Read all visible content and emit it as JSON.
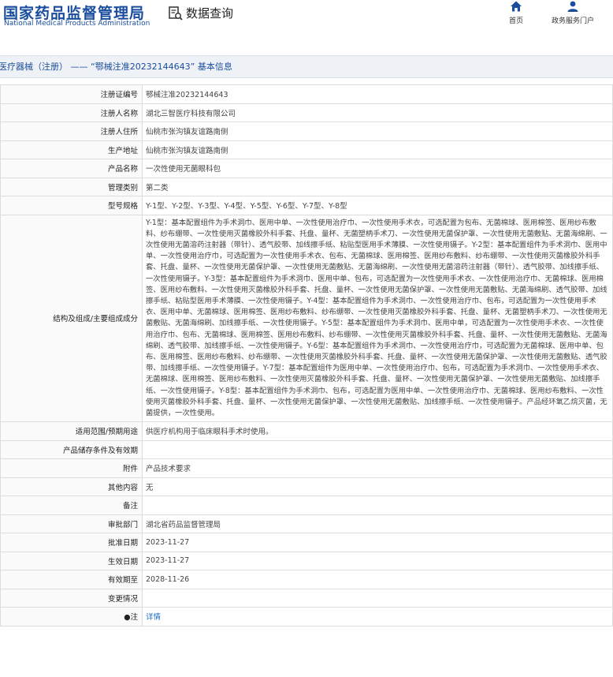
{
  "header": {
    "logo_cn": "国家药品监督管理局",
    "logo_en": "National Medical Products Administration",
    "data_query_label": "数据查询",
    "nav": [
      {
        "label": "首页",
        "icon": "home-icon"
      },
      {
        "label": "政务服务门户",
        "icon": "user-icon"
      }
    ]
  },
  "breadcrumb": "医疗器械（注册） —— “鄂械注准20232144643” 基本信息",
  "colors": {
    "brand": "#1a4d9e",
    "link": "#1a6cc7"
  },
  "rows": [
    {
      "label": "注册证编号",
      "value": "鄂械注准20232144643"
    },
    {
      "label": "注册人名称",
      "value": "湖北三智医疗科技有限公司"
    },
    {
      "label": "注册人住所",
      "value": "仙桃市张沟镇友谊路南侧"
    },
    {
      "label": "生产地址",
      "value": "仙桃市张沟镇友谊路南侧"
    },
    {
      "label": "产品名称",
      "value": "一次性使用无菌眼科包"
    },
    {
      "label": "管理类别",
      "value": "第二类"
    },
    {
      "label": "型号规格",
      "value": "Y-1型、Y-2型、Y-3型、Y-4型、Y-5型、Y-6型、Y-7型、Y-8型"
    },
    {
      "label": "结构及组成/主要组成成分",
      "value": "Y-1型：基本配置组件为手术洞巾、医用中单、一次性使用治疗巾、一次性使用手术衣，可选配置为包布、无菌棉球、医用棉签、医用纱布敷料、纱布绷带、一次性使用灭菌橡胶外科手套、托盘、量杯、无菌塑柄手术刀、一次性使用无菌保护罩、一次性使用无菌敷贴、无菌海绵刷、一次性使用无菌溶药注射器（带针）、透气胶带、加线擦手纸、粘贴型医用手术薄膜、一次性使用镊子。Y-2型：基本配置组件为手术洞巾、医用中单、一次性使用治疗巾，可选配置为一次性使用手术衣、包布、无菌棉球、医用棉签、医用纱布敷料、纱布绷带、一次性使用灭菌橡胶外科手套、托盘、量杯、一次性使用无菌保护罩、一次性使用无菌敷贴、无菌海绵刷、一次性使用无菌溶药注射器（带针）、透气胶带、加线擦手纸、一次性使用镊子。Y-3型：基本配置组件为手术洞巾、医用中单、包布，可选配置为一次性使用手术衣、一次性使用治疗巾、无菌棉球、医用棉签、医用纱布敷料、一次性使用灭菌橡胶外科手套、托盘、量杯、一次性使用无菌保护罩、一次性使用无菌敷贴、无菌海绵刷、透气胶带、加线擦手纸、粘贴型医用手术薄膜、一次性使用镊子。Y-4型：基本配置组件为手术洞巾、一次性使用治疗巾、包布，可选配置为一次性使用手术衣、医用中单、无菌棉球、医用棉签、医用纱布敷料、纱布绷带、一次性使用灭菌橡胶外科手套、托盘、量杯、无菌塑柄手术刀、一次性使用无菌敷贴、无菌海绵刷、加线擦手纸、一次性使用镊子。Y-5型：基本配置组件为手术洞巾、医用中单，可选配置为一次性使用手术衣、一次性使用治疗巾、包布、无菌棉球、医用棉签、医用纱布敷料、纱布绷带、一次性使用灭菌橡胶外科手套、托盘、量杯、一次性使用无菌敷贴、无菌海绵刷、透气胶带、加线擦手纸、一次性使用镊子。Y-6型：基本配置组件为手术洞巾、一次性使用治疗巾，可选配置为无菌棉球、医用中单、包布、医用棉签、医用纱布敷料、纱布绷带、一次性使用灭菌橡胶外科手套、托盘、量杯、一次性使用无菌保护罩、一次性使用无菌敷贴、透气胶带、加线擦手纸、一次性使用镊子。Y-7型：基本配置组件为医用中单、一次性使用治疗巾、包布，可选配置为手术洞巾、一次性使用手术衣、无菌棉球、医用棉签、医用纱布敷料、一次性使用灭菌橡胶外科手套、托盘、量杯、一次性使用无菌保护罩、一次性使用无菌敷贴、加线擦手纸、一次性使用镊子。Y-8型：基本配置组件为手术洞巾、包布，可选配置为医用中单、一次性使用治疗巾、无菌棉球、医用纱布敷料、一次性使用灭菌橡胶外科手套、托盘、量杯、一次性使用无菌保护罩、一次性使用无菌敷贴、加线擦手纸、一次性使用镊子。产品经环氧乙烷灭菌，无菌提供，一次性使用。"
    },
    {
      "label": "适用范围/预期用途",
      "value": "供医疗机构用于临床眼科手术时使用。"
    },
    {
      "label": "产品储存条件及有效期",
      "value": ""
    },
    {
      "label": "附件",
      "value": "产品技术要求"
    },
    {
      "label": "其他内容",
      "value": "无"
    },
    {
      "label": "备注",
      "value": ""
    },
    {
      "label": "审批部门",
      "value": "湖北省药品监督管理局"
    },
    {
      "label": "批准日期",
      "value": "2023-11-27"
    },
    {
      "label": "生效日期",
      "value": "2023-11-27"
    },
    {
      "label": "有效期至",
      "value": "2028-11-26"
    },
    {
      "label": "变更情况",
      "value": ""
    },
    {
      "label": "●注",
      "value": "详情"
    }
  ]
}
